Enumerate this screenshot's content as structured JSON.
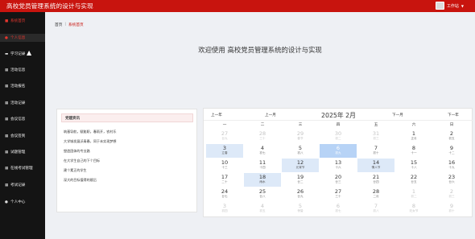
{
  "app_title": "高校党员管理系统的设计与实现",
  "user": {
    "name": "工作站"
  },
  "sidebar": {
    "items": [
      {
        "label": "系统首页",
        "icon": "home-icon"
      },
      {
        "label": "个人信息",
        "icon": "user-icon"
      },
      {
        "label": "学习记录",
        "icon": "list-icon"
      },
      {
        "label": "活动信息",
        "icon": "grid-icon"
      },
      {
        "label": "活动报名",
        "icon": "grid-icon"
      },
      {
        "label": "活动记录",
        "icon": "grid-icon"
      },
      {
        "label": "会议信息",
        "icon": "grid-icon"
      },
      {
        "label": "会议签到",
        "icon": "grid-icon"
      },
      {
        "label": "试题管理",
        "icon": "grid-icon"
      },
      {
        "label": "在线考试管理",
        "icon": "grid-icon"
      },
      {
        "label": "考试记录",
        "icon": "grid-icon"
      },
      {
        "label": "个人中心",
        "icon": "user-icon"
      }
    ]
  },
  "breadcrumb": {
    "home": "首页",
    "separator": "|",
    "current": "系统首页"
  },
  "welcome": "欢迎使用 高校党员管理系统的设计与实现",
  "panel": {
    "title": "党建资讯",
    "items": [
      "筑基导航，赋能职，春雨开，农村乐",
      "大学城发展沃青春，同于未实现梦想",
      "塑造团体的专业路",
      "在大学生自己的下个目标",
      "建个素正的学生",
      "深大的目标值得的赋后"
    ]
  },
  "calendar": {
    "title": "2025年 2月",
    "nav": {
      "prev_year": "上一年",
      "prev_month": "上一月",
      "next_month": "下一月",
      "next_year": "下一年"
    },
    "weekdays": [
      "一",
      "二",
      "三",
      "四",
      "五",
      "六",
      "日"
    ],
    "weeks": [
      [
        {
          "d": "27",
          "l": "廿九",
          "other": true
        },
        {
          "d": "28",
          "l": "三十",
          "other": true
        },
        {
          "d": "29",
          "l": "春节",
          "other": true
        },
        {
          "d": "30",
          "l": "初二",
          "other": true
        },
        {
          "d": "31",
          "l": "初三",
          "other": true
        },
        {
          "d": "1",
          "l": "正月"
        },
        {
          "d": "2",
          "l": "初五"
        }
      ],
      [
        {
          "d": "3",
          "l": "立春",
          "hl": true
        },
        {
          "d": "4",
          "l": "初七"
        },
        {
          "d": "5",
          "l": "初八"
        },
        {
          "d": "6",
          "l": "初九",
          "today": true
        },
        {
          "d": "7",
          "l": "初十"
        },
        {
          "d": "8",
          "l": "十一"
        },
        {
          "d": "9",
          "l": "十二"
        }
      ],
      [
        {
          "d": "10",
          "l": "十三"
        },
        {
          "d": "11",
          "l": "十四"
        },
        {
          "d": "12",
          "l": "元宵节",
          "hl": true
        },
        {
          "d": "13",
          "l": "十六"
        },
        {
          "d": "14",
          "l": "情人节",
          "hl": true
        },
        {
          "d": "15",
          "l": "十八"
        },
        {
          "d": "16",
          "l": "十九"
        }
      ],
      [
        {
          "d": "17",
          "l": "二十"
        },
        {
          "d": "18",
          "l": "雨水",
          "hl": true
        },
        {
          "d": "19",
          "l": "廿二"
        },
        {
          "d": "20",
          "l": "廿三"
        },
        {
          "d": "21",
          "l": "廿四"
        },
        {
          "d": "22",
          "l": "廿五"
        },
        {
          "d": "23",
          "l": "廿六"
        }
      ],
      [
        {
          "d": "24",
          "l": "廿七"
        },
        {
          "d": "25",
          "l": "廿八"
        },
        {
          "d": "26",
          "l": "廿九"
        },
        {
          "d": "27",
          "l": "三十"
        },
        {
          "d": "28",
          "l": "二月"
        },
        {
          "d": "1",
          "l": "初二",
          "other": true
        },
        {
          "d": "2",
          "l": "初三",
          "other": true
        }
      ],
      [
        {
          "d": "3",
          "l": "初四",
          "other": true
        },
        {
          "d": "4",
          "l": "初五",
          "other": true
        },
        {
          "d": "5",
          "l": "惊蛰",
          "other": true
        },
        {
          "d": "6",
          "l": "初七",
          "other": true
        },
        {
          "d": "7",
          "l": "初八",
          "other": true
        },
        {
          "d": "8",
          "l": "妇女节",
          "other": true
        },
        {
          "d": "9",
          "l": "初十",
          "other": true
        }
      ]
    ]
  },
  "colors": {
    "brand": "#c8140e",
    "sidebar": "#141414",
    "today": "#b7d3f6",
    "highlight": "#dde9f8"
  }
}
